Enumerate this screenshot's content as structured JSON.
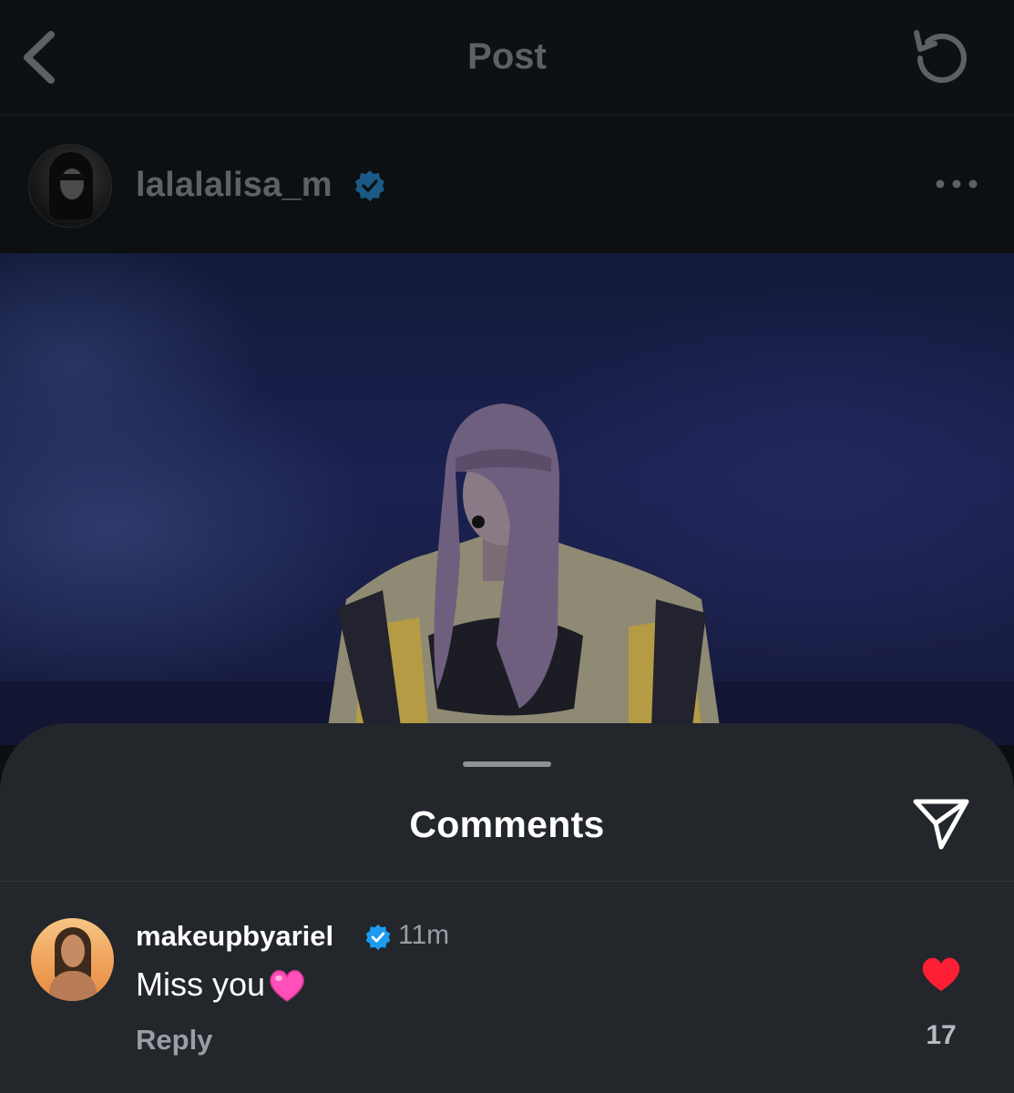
{
  "header": {
    "title": "Post",
    "back_icon": "chevron-left-icon",
    "refresh_icon": "refresh-icon"
  },
  "post": {
    "username": "lalalalisa_m",
    "verified": true,
    "more_icon": "more-dots-icon",
    "image_description_icon": "post-photo"
  },
  "comments_sheet": {
    "title": "Comments",
    "share_icon": "send-icon"
  },
  "comments": [
    {
      "username": "makeupbyariel",
      "verified": true,
      "time": "11m",
      "text": "Miss you",
      "emoji": "pink-heart",
      "reply_label": "Reply",
      "liked": true,
      "like_count": "17"
    }
  ],
  "colors": {
    "verified_blue": "#1d9bf0",
    "like_red": "#ff1f35",
    "sheet_bg": "#23262b"
  }
}
